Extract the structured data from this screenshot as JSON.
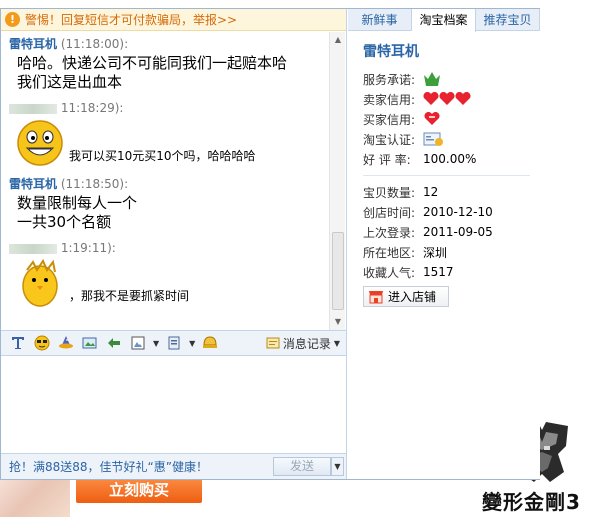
{
  "warning": {
    "icon": "warning-icon",
    "text": "警惕！回复短信才可付款骗局，举报>>"
  },
  "messages": [
    {
      "sender": "雷特耳机",
      "time": "(11:18:00):",
      "lines": [
        "哈哈。快递公司不可能同我们一起赔本哈",
        "我们这是出血本"
      ]
    },
    {
      "sender_redacted": true,
      "time": "11:18:29):",
      "emoji": "grinning-face-emoji",
      "text": "我可以买10元买10个吗，哈哈哈哈"
    },
    {
      "sender": "雷特耳机",
      "time": "(11:18:50):",
      "lines": [
        "数量限制每人一个",
        "一共30个名额"
      ]
    },
    {
      "sender_redacted": true,
      "time": "1:19:11):",
      "emoji": "yellow-chick-emoji",
      "text": "，那我不是要抓紧时间"
    }
  ],
  "toolbar": {
    "icons": [
      "font-icon",
      "emoticon-icon",
      "magic-hat-icon",
      "send-image-icon",
      "screenshot-icon",
      "picture-icon",
      "shake-icon",
      "bell-icon"
    ],
    "history_label": "消息记录"
  },
  "bottom": {
    "promo": "抢！满88送88，佳节好礼“惠”健康！",
    "send_label": "发送"
  },
  "tabs": [
    "新鲜事",
    "淘宝档案",
    "推荐宝贝"
  ],
  "active_tab": "淘宝档案",
  "shop": {
    "name": "雷特耳机",
    "rows": [
      {
        "label": "服务承诺:",
        "value": "",
        "icon": "promise-icon"
      },
      {
        "label": "卖家信用:",
        "value": "",
        "icon": "three-hearts-icon"
      },
      {
        "label": "买家信用:",
        "value": "",
        "icon": "heart-icon"
      },
      {
        "label": "淘宝认证:",
        "value": "",
        "icon": "certification-icon"
      },
      {
        "label": "好 评 率:",
        "value": "100.00%"
      }
    ],
    "stats": [
      {
        "label": "宝贝数量:",
        "value": "12"
      },
      {
        "label": "创店时间:",
        "value": "2010-12-10"
      },
      {
        "label": "上次登录:",
        "value": "2011-09-05"
      },
      {
        "label": "所在地区:",
        "value": "深圳"
      },
      {
        "label": "收藏人气:",
        "value": "1517"
      }
    ],
    "enter_label": "进入店铺"
  },
  "background": {
    "buy_button": "立刻购买",
    "logo_text": "變形金剛3"
  },
  "colors": {
    "link_blue": "#2a65a6",
    "warning_orange": "#d56a08",
    "buy_orange": "#ee5e12"
  }
}
